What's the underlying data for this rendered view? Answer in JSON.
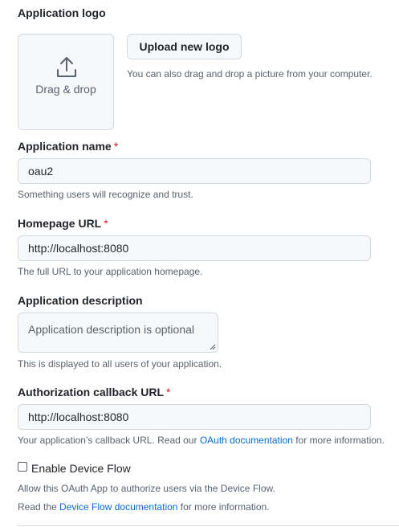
{
  "logo": {
    "label": "Application logo",
    "dropzone_label": "Drag & drop",
    "upload_button": "Upload new logo",
    "upload_hint": "You can also drag and drop a picture from your computer."
  },
  "app_name": {
    "label": "Application name",
    "required_mark": "*",
    "value": "oau2",
    "hint": "Something users will recognize and trust."
  },
  "homepage_url": {
    "label": "Homepage URL",
    "required_mark": "*",
    "value": "http://localhost:8080",
    "hint": "The full URL to your application homepage."
  },
  "description": {
    "label": "Application description",
    "placeholder": "Application description is optional",
    "hint": "This is displayed to all users of your application."
  },
  "callback_url": {
    "label": "Authorization callback URL",
    "required_mark": "*",
    "value": "http://localhost:8080",
    "hint_prefix": "Your application’s callback URL. Read our ",
    "hint_link": "OAuth documentation",
    "hint_suffix": " for more information."
  },
  "device_flow": {
    "label": "Enable Device Flow",
    "checked": false,
    "hint1": "Allow this OAuth App to authorize users via the Device Flow.",
    "hint2_prefix": "Read the ",
    "hint2_link": "Device Flow documentation",
    "hint2_suffix": " for more information."
  },
  "colors": {
    "link": "#0969da",
    "required": "#d1242f",
    "muted": "#59636e",
    "border": "#d1d9e0",
    "input_bg": "#f6f8fa"
  }
}
